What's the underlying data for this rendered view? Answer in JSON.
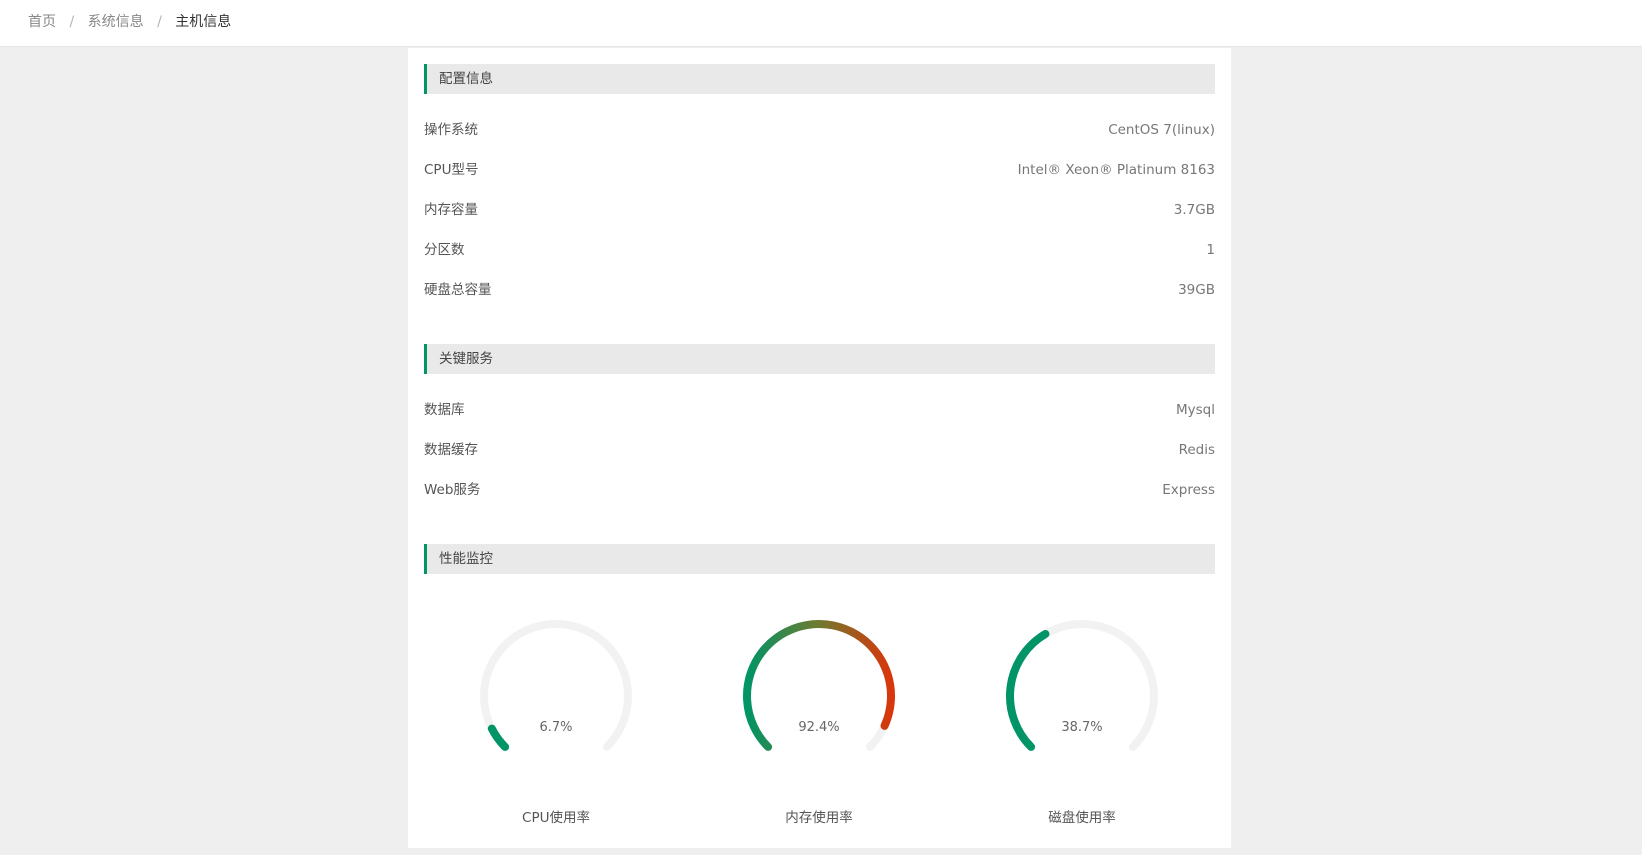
{
  "breadcrumb": {
    "items": [
      "首页",
      "系统信息",
      "主机信息"
    ],
    "separator": "/"
  },
  "config": {
    "title": "配置信息",
    "rows": [
      {
        "label": "操作系统",
        "value": "CentOS 7(linux)"
      },
      {
        "label": "CPU型号",
        "value": "Intel® Xeon® Platinum 8163"
      },
      {
        "label": "内存容量",
        "value": "3.7GB"
      },
      {
        "label": "分区数",
        "value": "1"
      },
      {
        "label": "硬盘总容量",
        "value": "39GB"
      }
    ]
  },
  "services": {
    "title": "关键服务",
    "rows": [
      {
        "label": "数据库",
        "value": "Mysql"
      },
      {
        "label": "数据缓存",
        "value": "Redis"
      },
      {
        "label": "Web服务",
        "value": "Express"
      }
    ]
  },
  "monitor": {
    "title": "性能监控",
    "gauges": [
      {
        "label": "CPU使用率",
        "value_text": "6.7%",
        "percent": 6.7
      },
      {
        "label": "内存使用率",
        "value_text": "92.4%",
        "percent": 92.4
      },
      {
        "label": "磁盘使用率",
        "value_text": "38.7%",
        "percent": 38.7
      }
    ]
  },
  "colors": {
    "accent": "#009467",
    "track": "#f2f2f2",
    "danger": "#d9360b"
  }
}
